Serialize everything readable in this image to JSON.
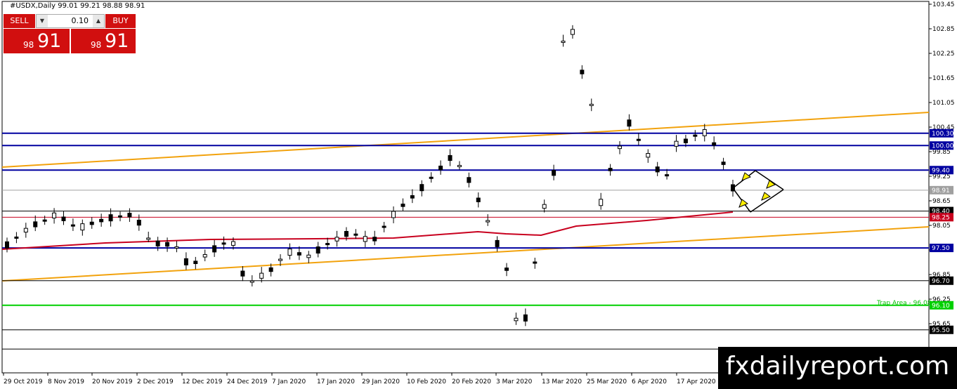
{
  "header": {
    "title": "#USDX,Daily  99.01 99.21 98.88 98.91"
  },
  "trade_panel": {
    "sell_label": "SELL",
    "buy_label": "BUY",
    "lot": "0.10",
    "sell_small": "98",
    "sell_big": "91",
    "buy_small": "98",
    "buy_big": "91"
  },
  "watermark": "fxdailyreport.com",
  "colors": {
    "blue": "#0000a0",
    "orange": "#f2a20d",
    "red": "#c8001e",
    "green": "#00d000",
    "gray": "#a0a0a0"
  },
  "chart_data": {
    "type": "candlestick",
    "symbol": "#USDX",
    "timeframe": "Daily",
    "ylim": [
      95.0,
      103.45
    ],
    "y_ticks": [
      "103.45",
      "102.85",
      "102.25",
      "101.65",
      "101.05",
      "100.45",
      "99.85",
      "99.25",
      "98.65",
      "98.05",
      "97.45",
      "96.85",
      "96.25",
      "95.65"
    ],
    "x_ticks": [
      "29 Oct 2019",
      "8 Nov 2019",
      "20 Nov 2019",
      "2 Dec 2019",
      "12 Dec 2019",
      "24 Dec 2019",
      "7 Jan 2020",
      "17 Jan 2020",
      "29 Jan 2020",
      "10 Feb 2020",
      "20 Feb 2020",
      "3 Mar 2020",
      "13 Mar 2020",
      "25 Mar 2020",
      "6 Apr 2020",
      "17 Apr 2020"
    ],
    "levels": [
      {
        "value": 100.3,
        "label": "100.30",
        "color": "blue"
      },
      {
        "value": 100.0,
        "label": "100.00",
        "color": "blue"
      },
      {
        "value": 99.4,
        "label": "99.40",
        "color": "blue"
      },
      {
        "value": 98.91,
        "label": "98.91",
        "color": "gray"
      },
      {
        "value": 98.4,
        "label": "98.40",
        "color": "black"
      },
      {
        "value": 98.25,
        "label": "98.25",
        "color": "red"
      },
      {
        "value": 97.5,
        "label": "97.50",
        "color": "blue"
      },
      {
        "value": 96.7,
        "label": "96.70",
        "color": "black"
      },
      {
        "value": 96.1,
        "label": "96.10",
        "color": "green"
      },
      {
        "value": 95.5,
        "label": "95.50",
        "color": "black"
      },
      {
        "value": 95.03,
        "label": "",
        "color": "black"
      }
    ],
    "annotation": {
      "text": "Trap Area - 96.08",
      "value": 96.1
    },
    "current_price": 98.91
  }
}
